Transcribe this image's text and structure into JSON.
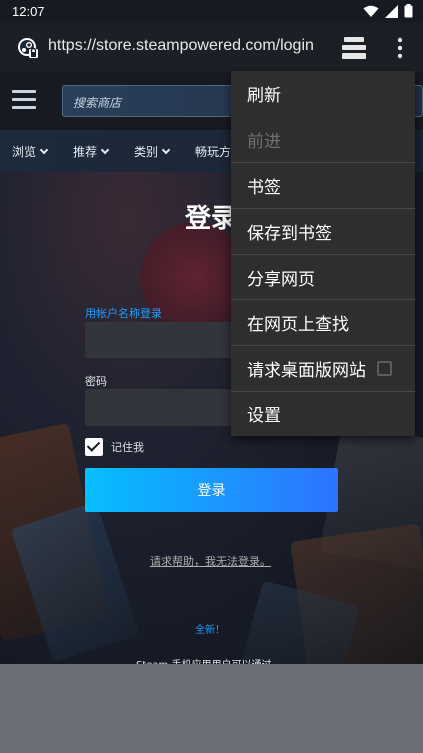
{
  "status_bar": {
    "time": "12:07"
  },
  "browser": {
    "url": "https://store.steampowered.com/login"
  },
  "store": {
    "search_placeholder": "搜索商店",
    "nav": [
      {
        "label": "浏览"
      },
      {
        "label": "推荐"
      },
      {
        "label": "类别"
      },
      {
        "label": "畅玩方"
      }
    ]
  },
  "login": {
    "title": "登录",
    "username_label": "用帐户名称登录",
    "password_label": "密码",
    "remember_label": "记住我",
    "remember_checked": true,
    "submit_label": "登录",
    "help_link": "请求帮助，我无法登录。",
    "new_label": "全新！",
    "app_promo": "Steam 手机应用用户可以通过"
  },
  "menu": {
    "items": [
      {
        "label": "刷新",
        "enabled": true
      },
      {
        "label": "前进",
        "enabled": false
      },
      {
        "label": "书签",
        "enabled": true
      },
      {
        "label": "保存到书签",
        "enabled": true
      },
      {
        "label": "分享网页",
        "enabled": true
      },
      {
        "label": "在网页上查找",
        "enabled": true
      },
      {
        "label": "请求桌面版网站",
        "enabled": true,
        "checkbox": false
      },
      {
        "label": "设置",
        "enabled": true
      }
    ]
  },
  "colors": {
    "accent_blue": "#1a9fff",
    "button_gradient_start": "#06bfff",
    "button_gradient_end": "#2d73ff",
    "menu_bg": "#2e2e2e",
    "steam_dark": "#171a21"
  }
}
